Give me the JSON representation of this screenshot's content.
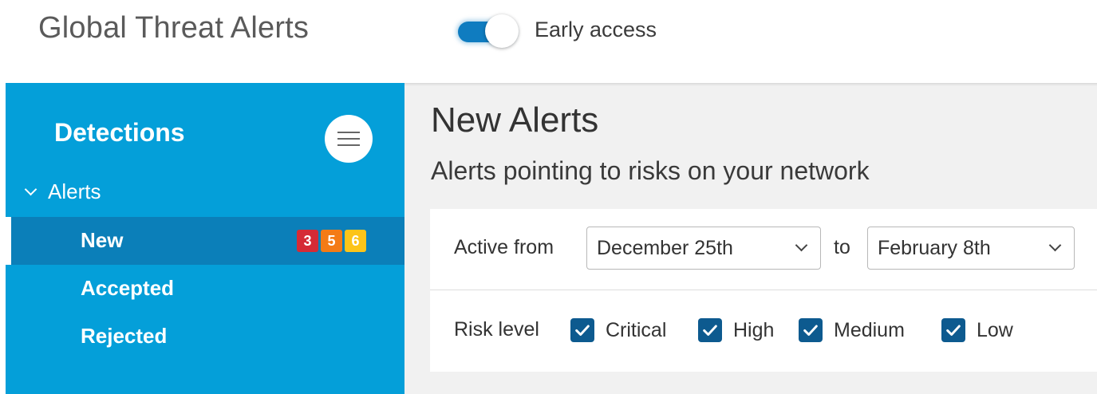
{
  "header": {
    "title": "Global Threat Alerts",
    "toggle": {
      "label": "Early access",
      "on": true
    }
  },
  "sidebar": {
    "title": "Detections",
    "group": {
      "label": "Alerts",
      "expanded": true
    },
    "items": [
      {
        "label": "New",
        "active": true
      },
      {
        "label": "Accepted",
        "active": false
      },
      {
        "label": "Rejected",
        "active": false
      }
    ],
    "badges": [
      {
        "value": "3",
        "color": "#d52b36"
      },
      {
        "value": "5",
        "color": "#f47b16"
      },
      {
        "value": "6",
        "color": "#fcc419"
      }
    ]
  },
  "main": {
    "title": "New Alerts",
    "subtitle": "Alerts pointing to risks on your network",
    "filters": {
      "active_from_label": "Active from",
      "from_value": "December 25th",
      "to_label": "to",
      "to_value": "February 8th",
      "risk_label": "Risk level",
      "risk_levels": [
        {
          "label": "Critical",
          "checked": true
        },
        {
          "label": "High",
          "checked": true
        },
        {
          "label": "Medium",
          "checked": true
        },
        {
          "label": "Low",
          "checked": true
        }
      ]
    }
  }
}
